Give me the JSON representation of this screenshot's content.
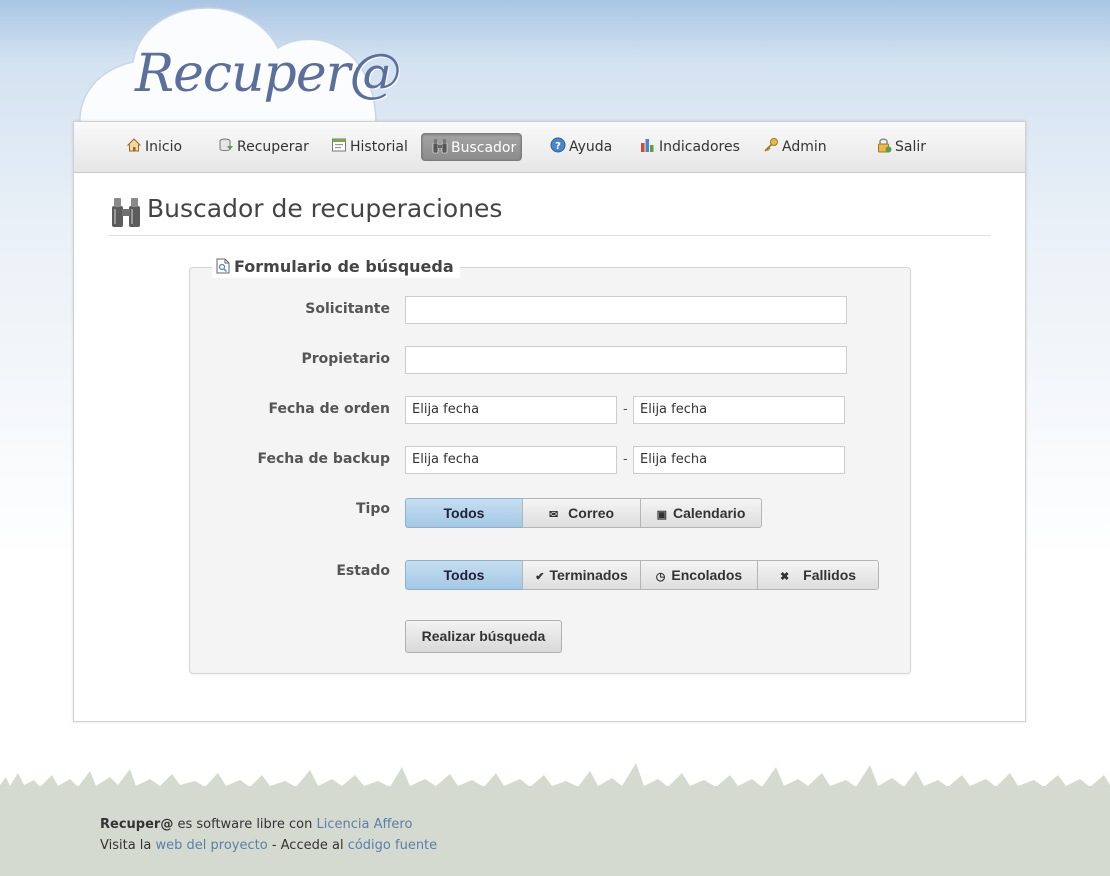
{
  "logo": {
    "text": "Recuper@"
  },
  "nav": {
    "items": [
      {
        "label": "Inicio",
        "icon": "home-icon"
      },
      {
        "label": "Recuperar",
        "icon": "database-icon"
      },
      {
        "label": "Historial",
        "icon": "history-icon"
      },
      {
        "label": "Buscador",
        "icon": "binoculars-icon",
        "active": true
      },
      {
        "label": "Ayuda",
        "icon": "help-icon"
      },
      {
        "label": "Indicadores",
        "icon": "bar-chart-icon"
      },
      {
        "label": "Admin",
        "icon": "key-icon"
      },
      {
        "label": "Salir",
        "icon": "lock-icon"
      }
    ]
  },
  "page": {
    "title": "Buscador de recuperaciones"
  },
  "form": {
    "legend": "Formulario de búsqueda",
    "labels": {
      "solicitante": "Solicitante",
      "propietario": "Propietario",
      "fecha_orden": "Fecha de orden",
      "fecha_backup": "Fecha de backup",
      "tipo": "Tipo",
      "estado": "Estado"
    },
    "solicitante_value": "",
    "propietario_value": "",
    "date_placeholder": "Elija fecha",
    "date_separator": "-",
    "tipo_options": [
      "Todos",
      "Correo",
      "Calendario"
    ],
    "tipo_selected": "Todos",
    "estado_options": [
      "Todos",
      "Terminados",
      "Encolados",
      "Fallidos"
    ],
    "estado_selected": "Todos",
    "submit_label": "Realizar búsqueda"
  },
  "footer": {
    "brand": "Recuper@",
    "line1_text": " es software libre con ",
    "license_link": "Licencia Affero",
    "line2_prefix": "Visita la ",
    "project_link": "web del proyecto",
    "line2_middle": " - Accede al ",
    "source_link": "código fuente"
  },
  "colors": {
    "accent_blue": "#a4c8e6",
    "link": "#5a7fa8",
    "logo": "#5a6f9c",
    "footer_bg": "#d5dad1"
  }
}
